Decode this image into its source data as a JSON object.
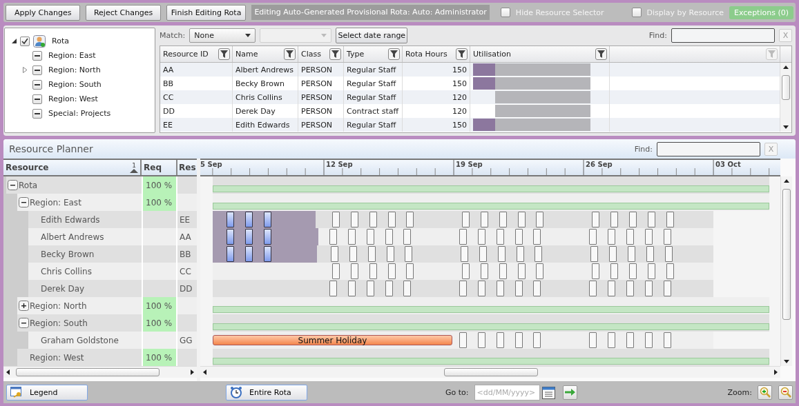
{
  "toolbar": {
    "buttons": [
      "Apply Changes",
      "Reject Changes",
      "Finish Editing Rota"
    ],
    "status": "Editing Auto-Generated Provisional Rota: Auto: Administrator",
    "options": [
      {
        "label": "Hide Resource Selector",
        "checked": false
      },
      {
        "label": "Display by Resource",
        "checked": false
      }
    ],
    "exceptions": "Exceptions (0)"
  },
  "selector": {
    "tree": {
      "label": "Rota",
      "checked": true,
      "expanded": true,
      "children": [
        {
          "label": "Region: East",
          "indeterminate": true,
          "expandable": false
        },
        {
          "label": "Region: North",
          "indeterminate": true,
          "expandable": true
        },
        {
          "label": "Region: South",
          "indeterminate": true,
          "expandable": false
        },
        {
          "label": "Region: West",
          "indeterminate": true,
          "expandable": false
        },
        {
          "label": "Special: Projects",
          "indeterminate": true,
          "expandable": false
        }
      ]
    },
    "filter": {
      "match_label": "Match:",
      "match_value": "None",
      "second_select": {
        "disabled": true
      },
      "date_button": "Select date range",
      "find_label": "Find:",
      "clear": "X"
    },
    "table": {
      "columns": [
        "Resource ID",
        "Name",
        "Class",
        "Type",
        "Rota Hours",
        "Utilisation"
      ],
      "rows": [
        {
          "cells": [
            "AA",
            "Albert Andrews",
            "PERSON",
            "Regular Staff",
            "150"
          ],
          "allocated": true
        },
        {
          "cells": [
            "BB",
            "Becky Brown",
            "PERSON",
            "Regular Staff",
            "150"
          ],
          "allocated": true
        },
        {
          "cells": [
            "CC",
            "Chris Collins",
            "PERSON",
            "Regular Staff",
            "120"
          ],
          "allocated": false
        },
        {
          "cells": [
            "DD",
            "Derek Day",
            "PERSON",
            "Contract staff",
            "120"
          ],
          "allocated": false
        },
        {
          "cells": [
            "EE",
            "Edith Edwards",
            "PERSON",
            "Regular Staff",
            "150"
          ],
          "allocated": true
        }
      ]
    }
  },
  "planner": {
    "title": "Resource Planner",
    "find_label": "Find:",
    "clear": "X",
    "columns": [
      "Resource",
      "Req",
      "Res"
    ],
    "sort_rank": "1",
    "timeline": [
      "5 Sep",
      "12 Sep",
      "19 Sep",
      "26 Sep",
      "03 Oct"
    ],
    "rows": [
      {
        "kind": "group",
        "label": "Rota",
        "req": "100 %",
        "expanded": true,
        "children": [
          {
            "kind": "group",
            "label": "Region: East",
            "req": "100 %",
            "expanded": true,
            "children": [
              {
                "kind": "person",
                "label": "Edith Edwards",
                "res": "EE",
                "highlighted": true
              },
              {
                "kind": "person",
                "label": "Albert Andrews",
                "res": "AA",
                "highlighted": true
              },
              {
                "kind": "person",
                "label": "Becky Brown",
                "res": "BB",
                "highlighted": true
              },
              {
                "kind": "person",
                "label": "Chris Collins",
                "res": "CC",
                "highlighted": false
              },
              {
                "kind": "person",
                "label": "Derek Day",
                "res": "DD",
                "highlighted": false
              }
            ]
          },
          {
            "kind": "group",
            "label": "Region: North",
            "req": "100 %",
            "expanded": false
          },
          {
            "kind": "group",
            "label": "Region: South",
            "req": "100 %",
            "expanded": true,
            "children": [
              {
                "kind": "person",
                "label": "Graham Goldstone",
                "res": "GG",
                "highlighted": false,
                "event": {
                  "kind": "holiday",
                  "label": "Summer Holiday"
                }
              }
            ]
          },
          {
            "kind": "group",
            "label": "Region: West",
            "req": "100 %"
          }
        ]
      }
    ]
  },
  "footer": {
    "legend": "Legend",
    "range": "Entire Rota",
    "goto_label": "Go to:",
    "date_placeholder": "<dd/MM/yyyy>",
    "zoom_label": "Zoom:"
  }
}
